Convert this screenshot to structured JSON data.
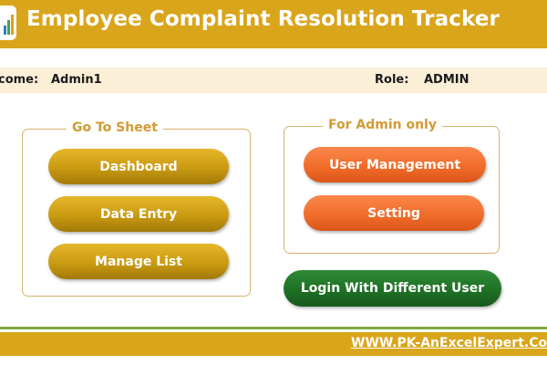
{
  "header": {
    "title": "Employee Complaint Resolution Tracker"
  },
  "welcome_bar": {
    "welcome_label": "come:",
    "user": "Admin1",
    "role_label": "Role:",
    "role": "ADMIN"
  },
  "go_to_sheet": {
    "title": "Go To Sheet",
    "buttons": [
      "Dashboard",
      "Data Entry",
      "Manage List"
    ]
  },
  "admin_only": {
    "title": "For Admin only",
    "buttons": [
      "User Management",
      "Setting"
    ]
  },
  "login_button": "Login With Different User",
  "footer": {
    "link": "WWW.PK-AnExcelExpert.Com"
  },
  "colors": {
    "header": "#d9a51b",
    "welcome_bar": "#fbefd8",
    "gold_button": "#c99a12",
    "orange_button": "#f06a28",
    "green_button": "#1e6e25",
    "group_title": "#d39a33",
    "footer_line": "#7fa83d"
  },
  "icons": {
    "logo": "bar-chart-logo-icon"
  }
}
